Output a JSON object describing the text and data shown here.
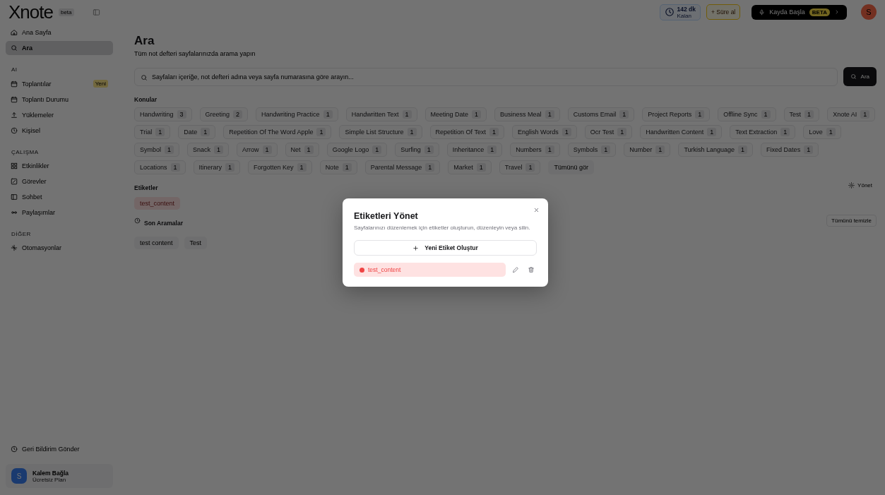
{
  "top_bar": {
    "logo": "Xnote",
    "logo_badge": "beta",
    "minutes": "142 dk",
    "minutes_caption": "Kalan",
    "add_time": "+ Süre al",
    "record": "Kayda Başla",
    "record_badge": "BETA",
    "avatar": "S"
  },
  "sidebar": {
    "sections": [
      {
        "items": [
          {
            "label": "Ana Sayfa",
            "selected": false
          },
          {
            "label": "Ara",
            "selected": true
          }
        ]
      },
      {
        "title": "AI",
        "items": [
          {
            "label": "Toplantılar",
            "selected": false,
            "badge": "Yeni"
          },
          {
            "label": "Toplantı Durumu",
            "selected": false
          },
          {
            "label": "Yüklemeler",
            "selected": false
          },
          {
            "label": "Kişisel",
            "selected": false
          }
        ]
      },
      {
        "title": "ÇALIŞMA",
        "items": [
          {
            "label": "Etkinlikler",
            "selected": false
          },
          {
            "label": "Görevler",
            "selected": false
          },
          {
            "label": "Sohbet",
            "selected": false
          },
          {
            "label": "Paylaşımlar",
            "selected": false
          }
        ]
      },
      {
        "title": "DİĞER",
        "items": [
          {
            "label": "Otomasyonlar",
            "selected": false
          }
        ]
      }
    ],
    "feedback": "Geri Bildirim Gönder",
    "user": {
      "initial": "S",
      "name": "Kalem Bağla",
      "plan": "Ücretsiz Plan"
    }
  },
  "main": {
    "title": "Ara",
    "subtitle": "Tüm not defteri sayfalarınızda arama yapın",
    "search": {
      "placeholder": "Sayfaları içeriğe, not defteri adına veya sayfa numarasına göre arayın...",
      "button": "Ara"
    },
    "topics": {
      "heading": "Konular",
      "items": [
        {
          "label": "Handwriting",
          "count": "3"
        },
        {
          "label": "Greeting",
          "count": "2"
        },
        {
          "label": "Handwriting Practice",
          "count": "1"
        },
        {
          "label": "Handwritten Text",
          "count": "1"
        },
        {
          "label": "Meeting Date",
          "count": "1"
        },
        {
          "label": "Business Meal",
          "count": "1"
        },
        {
          "label": "Customs Email",
          "count": "1"
        },
        {
          "label": "Project Reports",
          "count": "1"
        },
        {
          "label": "Offline Sync",
          "count": "1"
        },
        {
          "label": "Test",
          "count": "1"
        },
        {
          "label": "Xnote AI",
          "count": "1"
        },
        {
          "label": "Trial",
          "count": "1"
        },
        {
          "label": "Date",
          "count": "1"
        },
        {
          "label": "Repetition Of The Word Apple",
          "count": "1"
        },
        {
          "label": "Simple List Structure",
          "count": "1"
        },
        {
          "label": "Repetition Of Text",
          "count": "1"
        },
        {
          "label": "English Words",
          "count": "1"
        },
        {
          "label": "Ocr Test",
          "count": "1"
        },
        {
          "label": "Handwritten Content",
          "count": "1"
        },
        {
          "label": "Text Extraction",
          "count": "1"
        },
        {
          "label": "Love",
          "count": "1"
        },
        {
          "label": "Symbol",
          "count": "1"
        },
        {
          "label": "Snack",
          "count": "1"
        },
        {
          "label": "Arrow",
          "count": "1"
        },
        {
          "label": "Net",
          "count": "1"
        },
        {
          "label": "Google Logo",
          "count": "1"
        },
        {
          "label": "Surfing",
          "count": "1"
        },
        {
          "label": "Inheritance",
          "count": "1"
        },
        {
          "label": "Numbers",
          "count": "1"
        },
        {
          "label": "Symbols",
          "count": "1"
        },
        {
          "label": "Number",
          "count": "1"
        },
        {
          "label": "Turkish Language",
          "count": "1"
        },
        {
          "label": "Fixed Dates",
          "count": "1"
        },
        {
          "label": "Locations",
          "count": "1"
        },
        {
          "label": "Itinerary",
          "count": "1"
        },
        {
          "label": "Forgotten Key",
          "count": "1"
        },
        {
          "label": "Note",
          "count": "1"
        },
        {
          "label": "Parental Message",
          "count": "1"
        },
        {
          "label": "Market",
          "count": "1"
        },
        {
          "label": "Travel",
          "count": "1"
        }
      ],
      "show_all": "Tümünü gör"
    },
    "tags": {
      "heading": "Etiketler",
      "manage": "Yönet",
      "items": [
        {
          "label": "test_content"
        }
      ]
    },
    "recent": {
      "heading": "Son Aramalar",
      "clear": "Tümünü temizle",
      "items": [
        "test content",
        "Test"
      ]
    }
  },
  "modal": {
    "title": "Etiketleri Yönet",
    "description": "Sayfalarınızı düzenlemek için etiketler oluşturun, düzenleyin veya silin.",
    "create_button": "Yeni Etiket Oluştur",
    "tags": [
      {
        "label": "test_content",
        "color": "#ef4444"
      }
    ]
  }
}
